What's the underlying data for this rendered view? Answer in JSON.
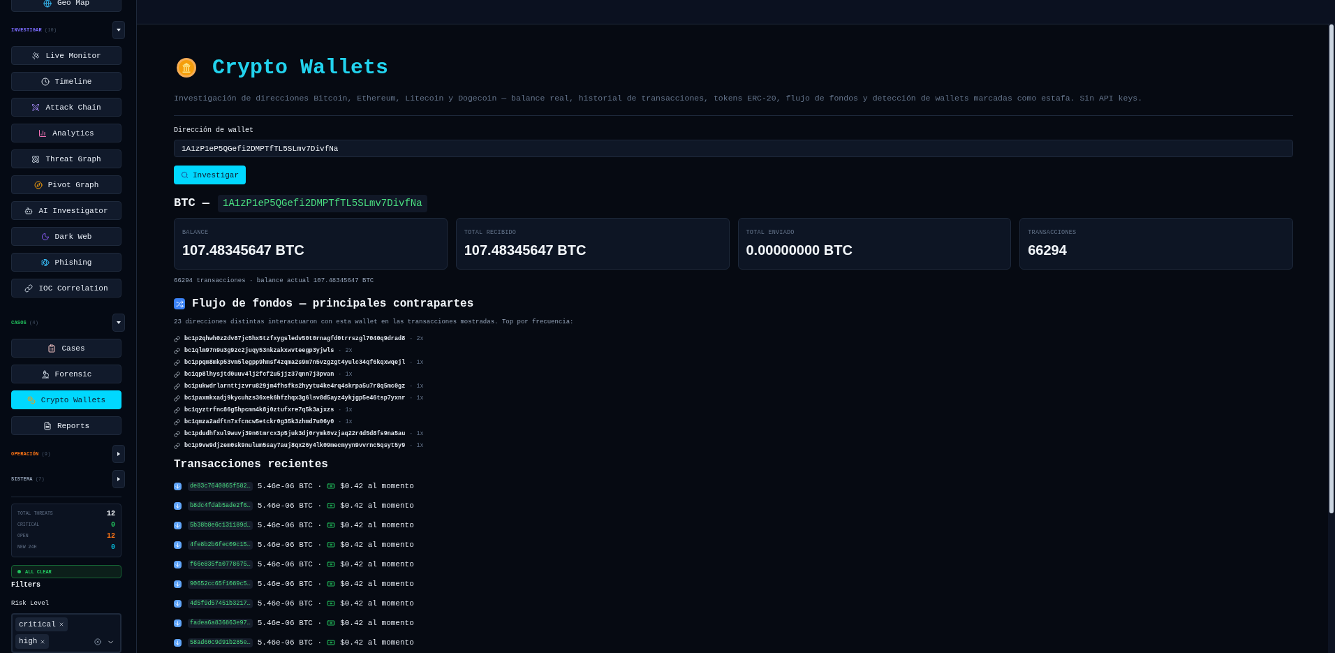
{
  "sidebar": {
    "top_item": {
      "label": "Geo Map"
    },
    "sections": [
      {
        "title": "INVESTIGAR",
        "count": "(10)",
        "color": "#7c6cff",
        "expanded": true,
        "items": [
          {
            "label": "Live Monitor",
            "selected": false
          },
          {
            "label": "Timeline",
            "selected": false
          },
          {
            "label": "Attack Chain",
            "selected": false
          },
          {
            "label": "Analytics",
            "selected": false
          },
          {
            "label": "Threat Graph",
            "selected": false
          },
          {
            "label": "Pivot Graph",
            "selected": false
          },
          {
            "label": "AI Investigator",
            "selected": false
          },
          {
            "label": "Dark Web",
            "selected": false
          },
          {
            "label": "Phishing",
            "selected": false
          },
          {
            "label": "IOC Correlation",
            "selected": false
          }
        ]
      },
      {
        "title": "CASOS",
        "count": "(4)",
        "color": "#22c55e",
        "expanded": true,
        "items": [
          {
            "label": "Cases",
            "selected": false
          },
          {
            "label": "Forensic",
            "selected": false
          },
          {
            "label": "Crypto Wallets",
            "selected": true
          },
          {
            "label": "Reports",
            "selected": false
          }
        ]
      },
      {
        "title": "OPERACIÓN",
        "count": "(9)",
        "color": "#f97316",
        "expanded": false
      },
      {
        "title": "SISTEMA",
        "count": "(7)",
        "color": "#94a3b8",
        "expanded": false
      }
    ],
    "stats": [
      {
        "label": "TOTAL THREATS",
        "value": "12",
        "color": "#f1f5f9"
      },
      {
        "label": "CRITICAL",
        "value": "0",
        "color": "#22c55e"
      },
      {
        "label": "OPEN",
        "value": "12",
        "color": "#f97316"
      },
      {
        "label": "NEW 24H",
        "value": "0",
        "color": "#06b6d4"
      }
    ],
    "status_badge": "ALL CLEAR",
    "filters": {
      "title": "Filters",
      "risk_label": "Risk Level",
      "chips": [
        "critical",
        "high"
      ]
    }
  },
  "page": {
    "title": "Crypto Wallets",
    "description": "Investigación de direcciones Bitcoin, Ethereum, Litecoin y Dogecoin — balance real, historial de transacciones, tokens ERC-20, flujo de fondos y detección de wallets marcadas como estafa. Sin API keys.",
    "wallet_field": {
      "label": "Dirección de wallet",
      "value": "1A1zP1eP5QGefi2DMPTfTL5SLmv7DivfNa"
    },
    "search_button": "Investigar",
    "result": {
      "coin": "BTC —",
      "address": "1A1zP1eP5QGefi2DMPTfTL5SLmv7DivfNa"
    },
    "cards": [
      {
        "label": "BALANCE",
        "value": "107.48345647 BTC"
      },
      {
        "label": "TOTAL RECIBIDO",
        "value": "107.48345647 BTC"
      },
      {
        "label": "TOTAL ENVIADO",
        "value": "0.00000000 BTC"
      },
      {
        "label": "TRANSACCIONES",
        "value": "66294"
      }
    ],
    "summary": "66294 transacciones · balance actual 107.48345647 BTC",
    "flow": {
      "title": "Flujo de fondos — principales contrapartes",
      "description": "23 direcciones distintas interactuaron con esta wallet en las transacciones mostradas. Top por frecuencia:",
      "items": [
        {
          "address": "bc1p2qhwh0z2dv87jc5hx5tzfxygsledv50t0rnagfd0trrszgl7040q9drad8",
          "count": "· 2x"
        },
        {
          "address": "bc1qlm97n9u3g9zc2juqy53nkzakxwvteegp3yjwls",
          "count": "· 2x"
        },
        {
          "address": "bc1ppqm8mkp53vm5legpp9hmsf4zqma2s9m7n5vzgzgt4yulc34qf6kqxwqejl",
          "count": "· 1x"
        },
        {
          "address": "bc1qp8lhysjtd0uuv4lj2fcf2u5jjz37qnn7j3pvan",
          "count": "· 1x"
        },
        {
          "address": "bc1pukwdrlarnttjzvru829jm4fhsfks2hyytu4ke4rq4skrpa5u7r8q5mc0gz",
          "count": "· 1x"
        },
        {
          "address": "bc1paxmkxadj9kycuhzs36xek6hfzhqx3g6lsv8d5ayz4ykjgp5e46tsp7yxnr",
          "count": "· 1x"
        },
        {
          "address": "bc1qyztrfnc86g5hpcmn4k8j0ztufxre7q5k3ajxzs",
          "count": "· 1x"
        },
        {
          "address": "bc1qmza2adftn7xfcncw5etckr0g35k3zhmd7u06y0",
          "count": "· 1x"
        },
        {
          "address": "bc1pdudhfxul9wuvj39n6tmrcx3p5juk3dj0rymk0vzjaq22r4d5d8fs9na5au",
          "count": "· 1x"
        },
        {
          "address": "bc1p9vw9djzem0sk9nulum5say7auj8qx26y4lk09mecmyyn9vvrnc5qsyt5y9",
          "count": "· 1x"
        }
      ]
    },
    "transactions": {
      "title": "Transacciones recientes",
      "rows": [
        {
          "hash": "de83c7640865f582…",
          "amount": "5.46e-06 BTC ·",
          "value": "$0.42 al momento"
        },
        {
          "hash": "b8dc4fdab5ade2f6…",
          "amount": "5.46e-06 BTC ·",
          "value": "$0.42 al momento"
        },
        {
          "hash": "5b38b8e6c131189d…",
          "amount": "5.46e-06 BTC ·",
          "value": "$0.42 al momento"
        },
        {
          "hash": "4fe8b2b6fec09c15…",
          "amount": "5.46e-06 BTC ·",
          "value": "$0.42 al momento"
        },
        {
          "hash": "f66e835fa0778675…",
          "amount": "5.46e-06 BTC ·",
          "value": "$0.42 al momento"
        },
        {
          "hash": "90652cc65f1089c5…",
          "amount": "5.46e-06 BTC ·",
          "value": "$0.42 al momento"
        },
        {
          "hash": "4d5f9d57451b3217…",
          "amount": "5.46e-06 BTC ·",
          "value": "$0.42 al momento"
        },
        {
          "hash": "fadea6a836863e97…",
          "amount": "5.46e-06 BTC ·",
          "value": "$0.42 al momento"
        },
        {
          "hash": "58ad60c9d91b285e…",
          "amount": "5.46e-06 BTC ·",
          "value": "$0.42 al momento"
        }
      ]
    }
  }
}
